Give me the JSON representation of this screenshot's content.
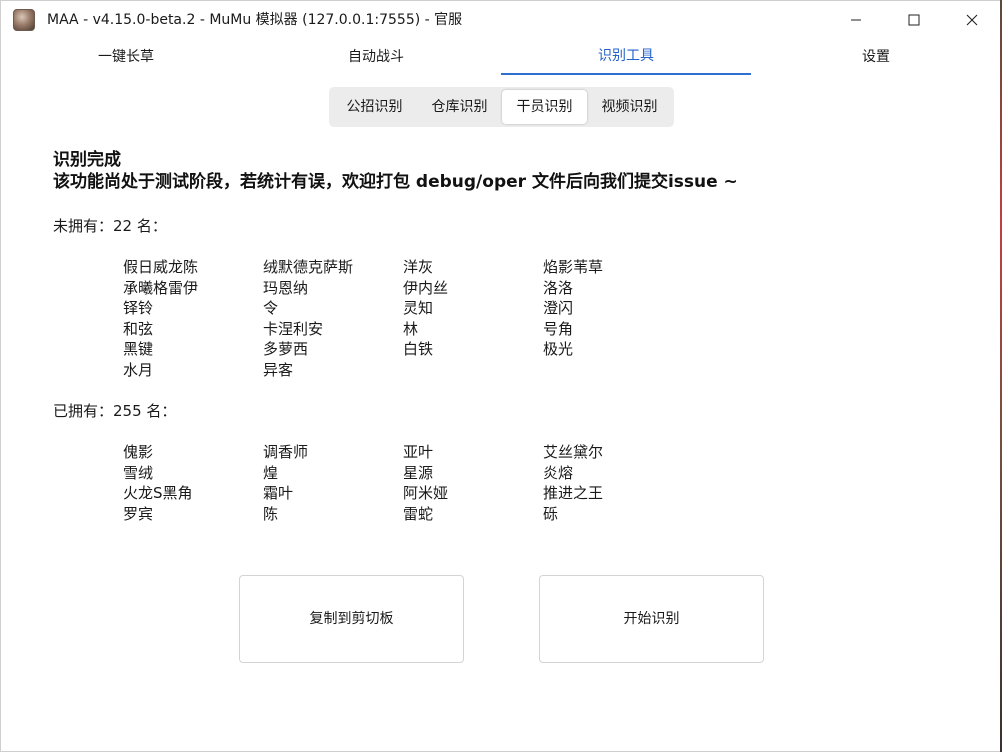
{
  "window": {
    "title": "MAA - v4.15.0-beta.2 - MuMu 模拟器 (127.0.0.1:7555) - 官服"
  },
  "main_tabs": [
    {
      "label": "一键长草",
      "active": false
    },
    {
      "label": "自动战斗",
      "active": false
    },
    {
      "label": "识别工具",
      "active": true
    },
    {
      "label": "设置",
      "active": false
    }
  ],
  "sub_tabs": [
    {
      "label": "公招识别",
      "active": false
    },
    {
      "label": "仓库识别",
      "active": false
    },
    {
      "label": "干员识别",
      "active": true
    },
    {
      "label": "视频识别",
      "active": false
    }
  ],
  "status": {
    "line1": "识别完成",
    "line2": "该功能尚处于测试阶段，若统计有误，欢迎打包 debug/oper 文件后向我们提交issue ~"
  },
  "unowned": {
    "prefix": "未拥有：",
    "count": "22",
    "suffix": " 名：",
    "names": [
      "假日威龙陈",
      "绒默德克萨斯",
      "洋灰",
      "焰影苇草",
      "承曦格雷伊",
      "玛恩纳",
      "伊内丝",
      "洛洛",
      "铎铃",
      "令",
      "灵知",
      "澄闪",
      "和弦",
      "卡涅利安",
      "林",
      "号角",
      "黑键",
      "多萝西",
      "白铁",
      "极光",
      "水月",
      "异客"
    ]
  },
  "owned": {
    "prefix": "已拥有：",
    "count": "255",
    "suffix": " 名：",
    "names": [
      "傀影",
      "调香师",
      "亚叶",
      "艾丝黛尔",
      "雪绒",
      "煌",
      "星源",
      "炎熔",
      "火龙S黑角",
      "霜叶",
      "阿米娅",
      "推进之王",
      "罗宾",
      "陈",
      "雷蛇",
      "砾"
    ]
  },
  "buttons": {
    "copy_label": "复制到剪切板",
    "start_label": "开始识别"
  },
  "colors": {
    "accent": "#2f6fd0",
    "accent_text": "#2563c9",
    "subtab_bg": "#ececec"
  },
  "icons": {
    "minimize": "minimize-icon",
    "maximize": "maximize-icon",
    "close": "close-icon",
    "app": "app-icon"
  }
}
